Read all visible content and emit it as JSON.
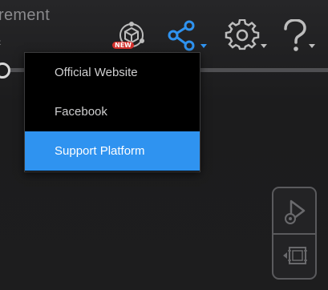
{
  "header": {
    "title_fragment": "rement",
    "left_glyph": "‹"
  },
  "toolbar": {
    "scan_new_badge": "NEW",
    "icons": [
      "scan-new-icon",
      "share-icon",
      "gear-icon",
      "help-icon"
    ]
  },
  "share_menu": {
    "items": [
      {
        "label": "Official Website",
        "active": false
      },
      {
        "label": "Facebook",
        "active": false
      },
      {
        "label": "Support Platform",
        "active": true
      }
    ]
  },
  "side_panel": {
    "icons": [
      "play-settings-icon",
      "collapse-frame-icon"
    ]
  },
  "colors": {
    "accent": "#2f93f0",
    "menu_bg": "#000000",
    "badge": "#d6302c",
    "icon_gray": "#bdbdbd"
  }
}
